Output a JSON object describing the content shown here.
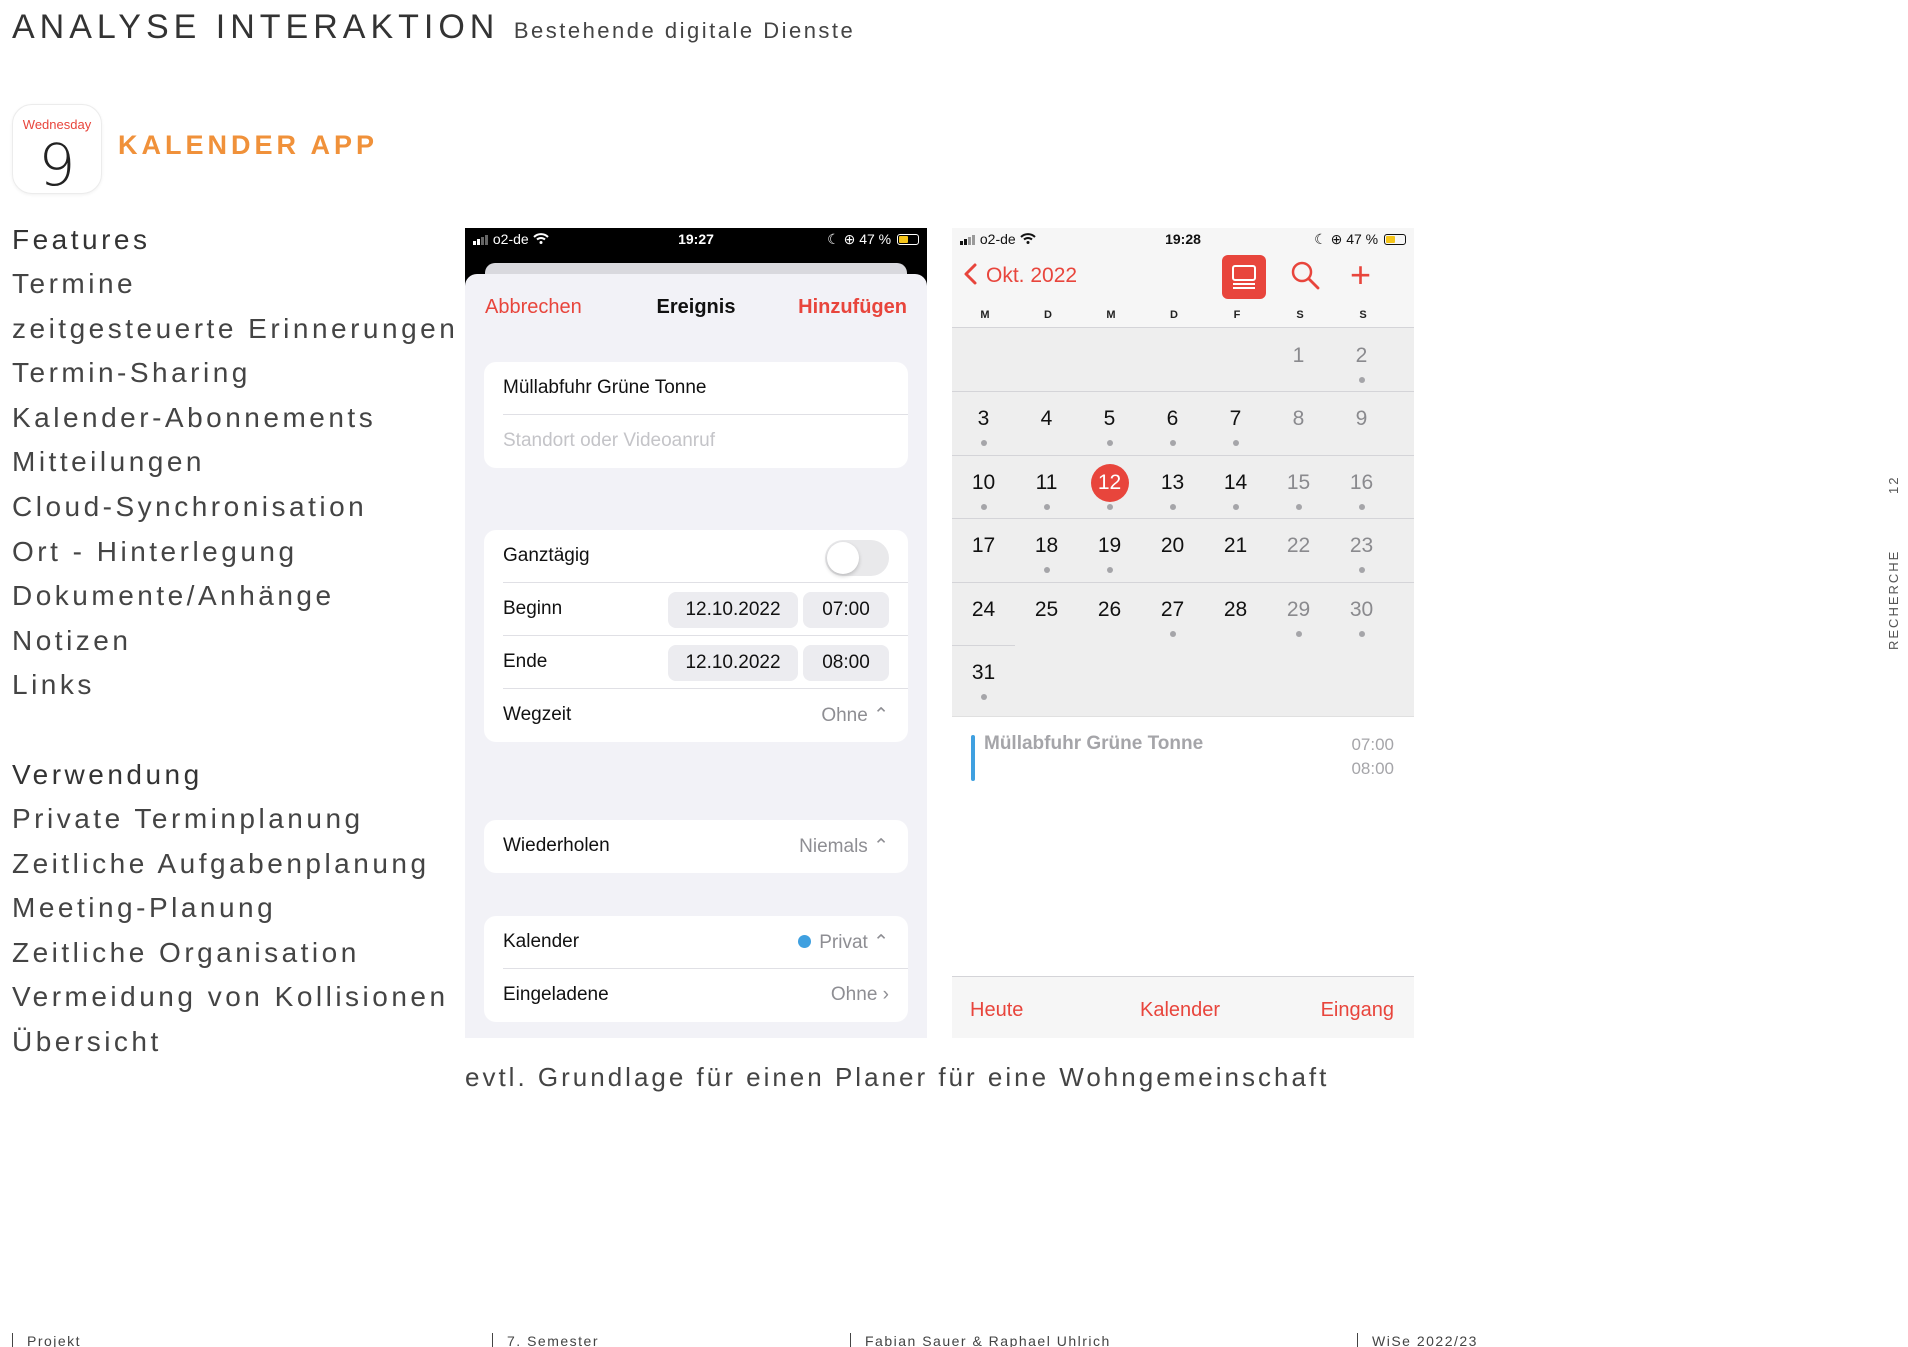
{
  "header": {
    "title": "ANALYSE INTERAKTION",
    "subtitle": "Bestehende digitale Dienste"
  },
  "app": {
    "icon_day": "Wednesday",
    "icon_date": "9",
    "title": "KALENDER APP"
  },
  "features": {
    "heading": "Features",
    "items": [
      "Termine",
      "zeitgesteuerte Erinnerungen",
      "Termin-Sharing",
      "Kalender-Abonnements",
      "Mitteilungen",
      "Cloud-Synchronisation",
      "Ort - Hinterlegung",
      "Dokumente/Anhänge",
      "Notizen",
      "Links"
    ]
  },
  "usage": {
    "heading": "Verwendung",
    "items": [
      "Private Terminplanung",
      "Zeitliche Aufgabenplanung",
      "Meeting-Planung",
      "Zeitliche Organisation",
      "Vermeidung von Kollisionen",
      "Übersicht"
    ]
  },
  "phone1": {
    "status": {
      "carrier": "o2-de",
      "time": "19:27",
      "battery": "47 %"
    },
    "nav": {
      "cancel": "Abbrechen",
      "title": "Ereignis",
      "add": "Hinzufügen"
    },
    "event_title": "Müllabfuhr Grüne Tonne",
    "location_placeholder": "Standort oder Videoanruf",
    "allday_label": "Ganztägig",
    "start_label": "Beginn",
    "start_date": "12.10.2022",
    "start_time": "07:00",
    "end_label": "Ende",
    "end_date": "12.10.2022",
    "end_time": "08:00",
    "travel_label": "Wegzeit",
    "travel_value": "Ohne ⌃",
    "repeat_label": "Wiederholen",
    "repeat_value": "Niemals ⌃",
    "calendar_label": "Kalender",
    "calendar_value": "Privat ⌃",
    "invitees_label": "Eingeladene",
    "invitees_value": "Ohne ›"
  },
  "phone2": {
    "status": {
      "carrier": "o2-de",
      "time": "19:28",
      "battery": "47 %"
    },
    "month": "Okt. 2022",
    "weekdays": [
      "M",
      "D",
      "M",
      "D",
      "F",
      "S",
      "S"
    ],
    "days": [
      {
        "d": "1",
        "col": 5,
        "row": 0,
        "dot": false
      },
      {
        "d": "2",
        "col": 6,
        "row": 0,
        "dot": true
      },
      {
        "d": "3",
        "col": 0,
        "row": 1,
        "dot": true
      },
      {
        "d": "4",
        "col": 1,
        "row": 1,
        "dot": false
      },
      {
        "d": "5",
        "col": 2,
        "row": 1,
        "dot": true
      },
      {
        "d": "6",
        "col": 3,
        "row": 1,
        "dot": true
      },
      {
        "d": "7",
        "col": 4,
        "row": 1,
        "dot": true
      },
      {
        "d": "8",
        "col": 5,
        "row": 1,
        "dot": false
      },
      {
        "d": "9",
        "col": 6,
        "row": 1,
        "dot": false
      },
      {
        "d": "10",
        "col": 0,
        "row": 2,
        "dot": true
      },
      {
        "d": "11",
        "col": 1,
        "row": 2,
        "dot": true
      },
      {
        "d": "12",
        "col": 2,
        "row": 2,
        "dot": true,
        "today": true
      },
      {
        "d": "13",
        "col": 3,
        "row": 2,
        "dot": true
      },
      {
        "d": "14",
        "col": 4,
        "row": 2,
        "dot": true
      },
      {
        "d": "15",
        "col": 5,
        "row": 2,
        "dot": true
      },
      {
        "d": "16",
        "col": 6,
        "row": 2,
        "dot": true
      },
      {
        "d": "17",
        "col": 0,
        "row": 3,
        "dot": false
      },
      {
        "d": "18",
        "col": 1,
        "row": 3,
        "dot": true
      },
      {
        "d": "19",
        "col": 2,
        "row": 3,
        "dot": true
      },
      {
        "d": "20",
        "col": 3,
        "row": 3,
        "dot": false
      },
      {
        "d": "21",
        "col": 4,
        "row": 3,
        "dot": false
      },
      {
        "d": "22",
        "col": 5,
        "row": 3,
        "dot": false
      },
      {
        "d": "23",
        "col": 6,
        "row": 3,
        "dot": true
      },
      {
        "d": "24",
        "col": 0,
        "row": 4,
        "dot": false
      },
      {
        "d": "25",
        "col": 1,
        "row": 4,
        "dot": false
      },
      {
        "d": "26",
        "col": 2,
        "row": 4,
        "dot": false
      },
      {
        "d": "27",
        "col": 3,
        "row": 4,
        "dot": true
      },
      {
        "d": "28",
        "col": 4,
        "row": 4,
        "dot": false
      },
      {
        "d": "29",
        "col": 5,
        "row": 4,
        "dot": true
      },
      {
        "d": "30",
        "col": 6,
        "row": 4,
        "dot": true
      },
      {
        "d": "31",
        "col": 0,
        "row": 5,
        "dot": true
      }
    ],
    "event": {
      "title": "Müllabfuhr Grüne Tonne",
      "start": "07:00",
      "end": "08:00"
    },
    "tabs": {
      "today": "Heute",
      "calendar": "Kalender",
      "inbox": "Eingang"
    }
  },
  "caption": "evtl. Grundlage für einen Planer für eine Wohngemeinschaft",
  "side": {
    "page": "12",
    "section": "RECHERCHE"
  },
  "footer": {
    "project": "Projekt",
    "semester": "7. Semester",
    "authors": "Fabian Sauer & Raphael Uhlrich",
    "term": "WiSe 2022/23"
  },
  "colors": {
    "accent_orange": "#f0913a",
    "ios_red": "#e8453c",
    "event_blue": "#3fa0e0"
  },
  "icons": [
    "signal-icon",
    "wifi-icon",
    "moon-icon",
    "rotation-lock-icon",
    "battery-icon",
    "chevron-left-icon",
    "list-view-icon",
    "search-icon",
    "plus-icon"
  ]
}
